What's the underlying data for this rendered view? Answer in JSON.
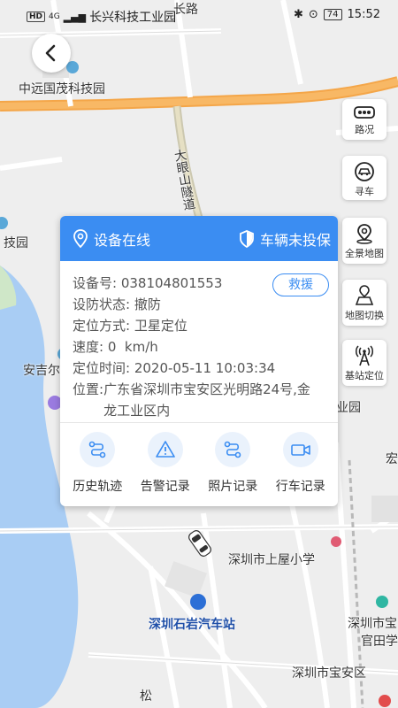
{
  "status_bar": {
    "left_tag": "HD",
    "network": "4G",
    "carrier_overlay": "长兴科技工业园",
    "battery": "74",
    "time": "15:52"
  },
  "map": {
    "labels": {
      "zhongyuan": "中远国茂科技园",
      "changxing": "长兴科技工业园",
      "road_top": "长路",
      "tunnel": "大眼山隧道",
      "tech_park_left": "技园",
      "anji": "安吉尔",
      "qu_yuan": "业园",
      "hong": "宏",
      "shangwu_school": "深圳市上屋小学",
      "shiyan_station": "深圳石岩汽车站",
      "bao_tian": "深圳市宝",
      "guantian": "官田学",
      "baoan": "深圳市宝安区",
      "song": "松"
    }
  },
  "side_buttons": [
    {
      "label": "路况",
      "icon": "traffic-icon"
    },
    {
      "label": "寻车",
      "icon": "find-car-icon"
    },
    {
      "label": "全景地图",
      "icon": "panorama-map-icon"
    },
    {
      "label": "地图切换",
      "icon": "map-switch-icon"
    },
    {
      "label": "基站定位",
      "icon": "base-station-icon"
    }
  ],
  "card": {
    "online_status": "设备在线",
    "defense_status": "车辆未投保",
    "rescue_label": "救援",
    "device_no_label": "设备号:",
    "device_no": "038104801553",
    "defense_label": "设防状态:",
    "defense_value": "撤防",
    "locate_mode_label": "定位方式:",
    "locate_mode": "卫星定位",
    "speed_label": "速度:",
    "speed": "0  km/h",
    "locate_time_label": "定位时间:",
    "locate_time": "2020-05-11 10:03:34",
    "position_label": "位置:",
    "position": "广东省深圳市宝安区光明路24号,金龙工业区内",
    "actions": [
      {
        "label": "历史轨迹",
        "icon": "track-history-icon"
      },
      {
        "label": "告警记录",
        "icon": "alarm-warning-icon"
      },
      {
        "label": "照片记录",
        "icon": "photo-record-icon"
      },
      {
        "label": "行车记录",
        "icon": "dashcam-video-icon"
      }
    ]
  },
  "colors": {
    "accent": "#3b8df2",
    "major_road": "#f4a649",
    "map_bg": "#eeeeee"
  }
}
